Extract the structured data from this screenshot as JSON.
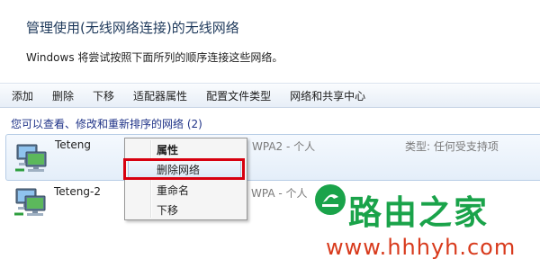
{
  "header": {
    "title": "管理使用(无线网络连接)的无线网络",
    "subtitle": "Windows 将尝试按照下面所列的顺序连接这些网络。"
  },
  "toolbar": {
    "buttons": [
      "添加",
      "删除",
      "下移",
      "适配器属性",
      "配置文件类型",
      "网络和共享中心"
    ]
  },
  "section_label": "您可以查看、修改和重新排序的网络 (2)",
  "networks": [
    {
      "name": "Teteng",
      "security": "WPA2 - 个人",
      "type": "类型: 任何受支持项",
      "selected": true
    },
    {
      "name": "Teteng-2",
      "security": "WPA - 个人",
      "type": "",
      "selected": false
    }
  ],
  "context_menu": {
    "items": [
      "属性",
      "删除网络",
      "重命名",
      "下移"
    ],
    "default_item": "属性",
    "highlighted_item": "删除网络"
  },
  "watermark": {
    "text": "路由之家",
    "url": "www.hhhyh.com"
  },
  "colors": {
    "title": "#1e395b",
    "section": "#1e3287",
    "highlight_box": "#d7000f",
    "watermark_green": "#1aa34a",
    "watermark_red": "#d83a1c"
  }
}
